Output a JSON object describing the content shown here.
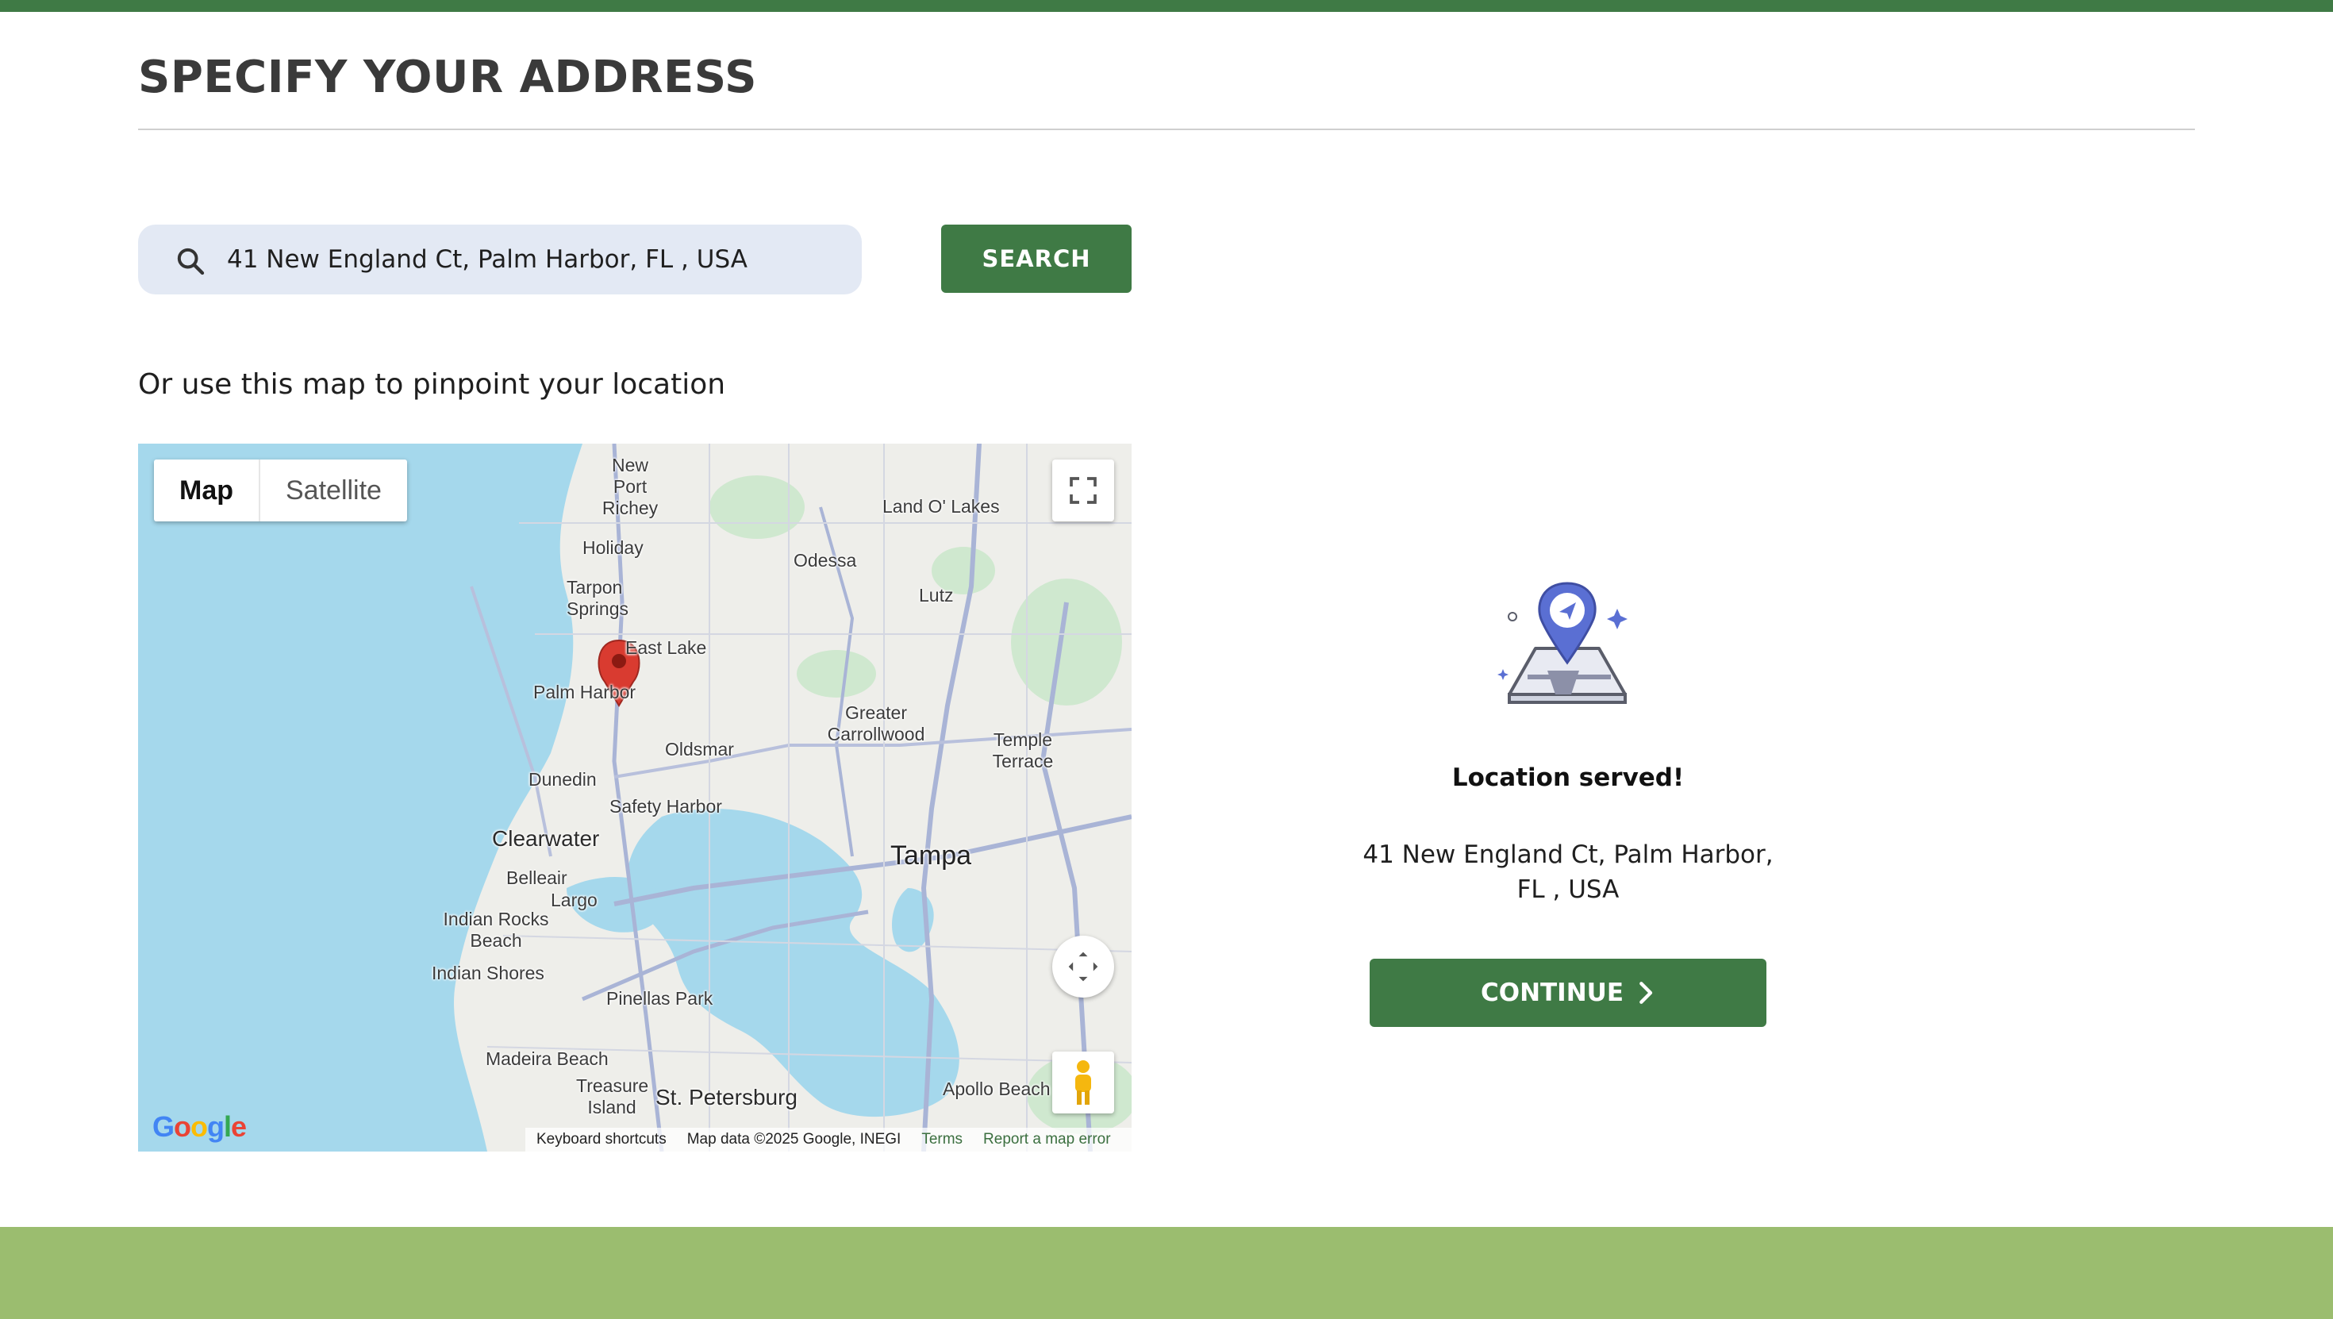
{
  "page": {
    "title": "SPECIFY YOUR ADDRESS",
    "colors": {
      "brand_green": "#3f7a45",
      "footer_green": "#9bbd6f",
      "search_bg": "#e3e9f4"
    }
  },
  "search": {
    "value": "41 New England Ct, Palm Harbor, FL , USA",
    "icon": "search-icon",
    "button_label": "SEARCH"
  },
  "map_section": {
    "hint": "Or use this map to pinpoint your location",
    "map_type": {
      "active": "Map",
      "other": "Satellite"
    },
    "labels": {
      "new_port_richey": "New Port Richey",
      "land_o_lakes": "Land O' Lakes",
      "holiday": "Holiday",
      "odessa": "Odessa",
      "tarpon_springs": "Tarpon Springs",
      "lutz": "Lutz",
      "east_lake": "East Lake",
      "palm_harbor": "Palm Harbor",
      "greater_carrollwood": "Greater Carrollwood",
      "oldsmar": "Oldsmar",
      "temple_terrace": "Temple Terrace",
      "dunedin": "Dunedin",
      "safety_harbor": "Safety Harbor",
      "clearwater": "Clearwater",
      "tampa": "Tampa",
      "belleair": "Belleair",
      "largo": "Largo",
      "indian_rocks_beach": "Indian Rocks Beach",
      "indian_shores": "Indian Shores",
      "pinellas_park": "Pinellas Park",
      "madeira_beach": "Madeira Beach",
      "treasure_island": "Treasure Island",
      "st_petersburg": "St. Petersburg",
      "apollo_beach": "Apollo Beach"
    },
    "google_logo": "Google",
    "attribution": {
      "shortcuts": "Keyboard shortcuts",
      "data": "Map data ©2025 Google, INEGI",
      "terms": "Terms",
      "report": "Report a map error"
    }
  },
  "result": {
    "illustration": "location-map-pin-illustration",
    "title": "Location served!",
    "address": "41 New England Ct, Palm Harbor, FL , USA",
    "continue_label": "CONTINUE",
    "continue_icon": "chevron-right-icon"
  }
}
